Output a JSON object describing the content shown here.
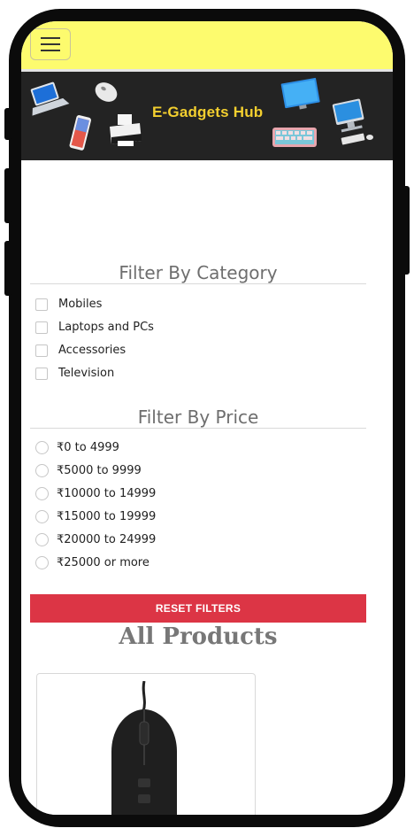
{
  "app": {
    "brand_name": "E-Gadgets Hub"
  },
  "colors": {
    "topbar": "#fdfb6e",
    "banner": "#232323",
    "brand_text": "#f3cf2f",
    "reset_button": "#dc3545"
  },
  "filters": {
    "category_title": "Filter By Category",
    "categories": [
      {
        "label": "Mobiles",
        "checked": false
      },
      {
        "label": "Laptops and PCs",
        "checked": false
      },
      {
        "label": "Accessories",
        "checked": false
      },
      {
        "label": "Television",
        "checked": false
      }
    ],
    "price_title": "Filter By Price",
    "prices": [
      {
        "label": "₹0 to 4999",
        "selected": false
      },
      {
        "label": "₹5000 to 9999",
        "selected": false
      },
      {
        "label": "₹10000 to 14999",
        "selected": false
      },
      {
        "label": "₹15000 to 19999",
        "selected": false
      },
      {
        "label": "₹20000 to 24999",
        "selected": false
      },
      {
        "label": "₹25000 or more",
        "selected": false
      }
    ],
    "reset_label": "RESET FILTERS"
  },
  "products": {
    "section_title": "All Products",
    "items": [
      {
        "image_icon": "mouse-icon"
      }
    ]
  }
}
